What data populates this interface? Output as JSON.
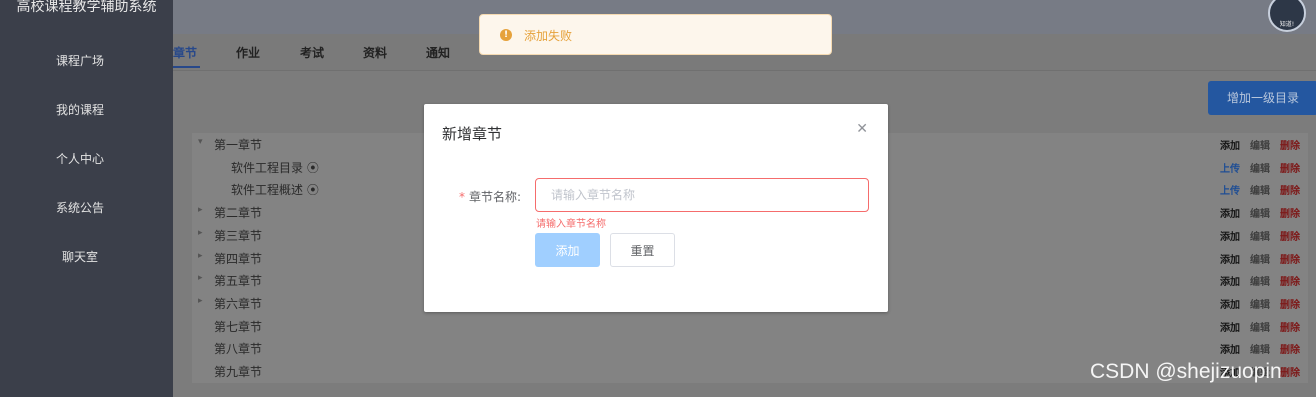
{
  "app": {
    "title": "高校课程教学辅助系统",
    "avatar_text": "知道!"
  },
  "sidebar": {
    "items": [
      {
        "label": "课程广场"
      },
      {
        "label": "我的课程"
      },
      {
        "label": "个人中心"
      },
      {
        "label": "系统公告"
      },
      {
        "label": "聊天室"
      }
    ]
  },
  "tabs": [
    {
      "label": "章节",
      "active": true
    },
    {
      "label": "作业"
    },
    {
      "label": "考试"
    },
    {
      "label": "资料"
    },
    {
      "label": "通知"
    }
  ],
  "toolbar": {
    "add_top_label": "增加一级目录"
  },
  "tree": {
    "rows": [
      {
        "label": "第一章节",
        "caret": "▾",
        "actions": [
          "添加",
          "编辑",
          "删除"
        ]
      },
      {
        "label": "软件工程目录 ⦿",
        "indent": true,
        "actions": [
          "上传",
          "编辑",
          "删除"
        ]
      },
      {
        "label": "软件工程概述 ⦿",
        "indent": true,
        "actions": [
          "上传",
          "编辑",
          "删除"
        ]
      },
      {
        "label": "第二章节",
        "caret": "▸",
        "actions": [
          "添加",
          "编辑",
          "删除"
        ]
      },
      {
        "label": "第三章节",
        "caret": "▸",
        "actions": [
          "添加",
          "编辑",
          "删除"
        ]
      },
      {
        "label": "第四章节",
        "caret": "▸",
        "actions": [
          "添加",
          "编辑",
          "删除"
        ]
      },
      {
        "label": "第五章节",
        "caret": "▸",
        "actions": [
          "添加",
          "编辑",
          "删除"
        ]
      },
      {
        "label": "第六章节",
        "caret": "▸",
        "actions": [
          "添加",
          "编辑",
          "删除"
        ]
      },
      {
        "label": "第七章节",
        "actions": [
          "添加",
          "编辑",
          "删除"
        ]
      },
      {
        "label": "第八章节",
        "actions": [
          "添加",
          "编辑",
          "删除"
        ]
      },
      {
        "label": "第九章节",
        "actions": [
          "添加",
          "编辑",
          "删除"
        ]
      }
    ]
  },
  "toast": {
    "icon": "warning-icon",
    "message": "添加失败",
    "color": "#e6a23c"
  },
  "dialog": {
    "title": "新增章节",
    "field_label": "章节名称:",
    "required_mark": "*",
    "input_value": "",
    "input_placeholder": "请输入章节名称",
    "error_text": "请输入章节名称",
    "add_label": "添加",
    "reset_label": "重置",
    "close_icon": "close-icon"
  },
  "watermark": "CSDN @shejizuopin"
}
